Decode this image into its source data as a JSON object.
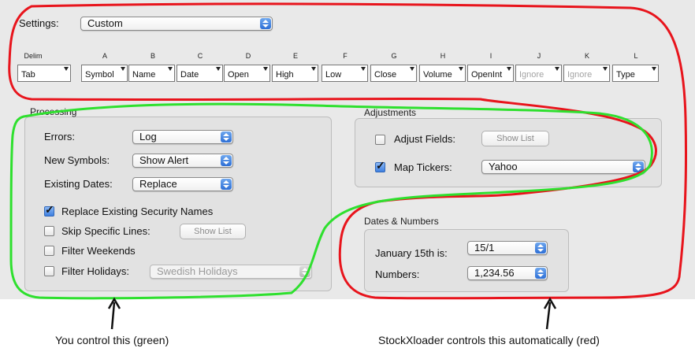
{
  "settings": {
    "label": "Settings:",
    "value": "Custom"
  },
  "columns": [
    {
      "letter": "Delim",
      "field": "Tab",
      "dim": false
    },
    {
      "letter": "A",
      "field": "Symbol",
      "dim": false
    },
    {
      "letter": "B",
      "field": "Name",
      "dim": false
    },
    {
      "letter": "C",
      "field": "Date",
      "dim": false
    },
    {
      "letter": "D",
      "field": "Open",
      "dim": false
    },
    {
      "letter": "E",
      "field": "High",
      "dim": false
    },
    {
      "letter": "F",
      "field": "Low",
      "dim": false
    },
    {
      "letter": "G",
      "field": "Close",
      "dim": false
    },
    {
      "letter": "H",
      "field": "Volume",
      "dim": false
    },
    {
      "letter": "I",
      "field": "OpenInt",
      "dim": false
    },
    {
      "letter": "J",
      "field": "Ignore",
      "dim": true
    },
    {
      "letter": "K",
      "field": "Ignore",
      "dim": true
    },
    {
      "letter": "L",
      "field": "Type",
      "dim": false
    }
  ],
  "processing": {
    "title": "Processing",
    "errors": {
      "label": "Errors:",
      "value": "Log"
    },
    "new_symbols": {
      "label": "New Symbols:",
      "value": "Show Alert"
    },
    "existing_dates": {
      "label": "Existing Dates:",
      "value": "Replace"
    },
    "replace_names": {
      "label": "Replace Existing Security Names",
      "checked": true
    },
    "skip_lines": {
      "label": "Skip Specific Lines:",
      "checked": false,
      "button": "Show List"
    },
    "filter_weekends": {
      "label": "Filter Weekends",
      "checked": false
    },
    "filter_holidays": {
      "label": "Filter Holidays:",
      "checked": false,
      "value": "Swedish Holidays"
    }
  },
  "adjustments": {
    "title": "Adjustments",
    "adjust_fields": {
      "label": "Adjust Fields:",
      "checked": false,
      "button": "Show List"
    },
    "map_tickers": {
      "label": "Map Tickers:",
      "checked": true,
      "value": "Yahoo"
    }
  },
  "dates_numbers": {
    "title": "Dates & Numbers",
    "january": {
      "label": "January 15th is:",
      "value": "15/1"
    },
    "numbers": {
      "label": "Numbers:",
      "value": "1,234.56"
    }
  },
  "captions": {
    "green": "You control this (green)",
    "red": "StockXloader controls this automatically (red)"
  },
  "colors": {
    "annotation_red": "#e8141c",
    "annotation_green": "#2ee02e"
  }
}
